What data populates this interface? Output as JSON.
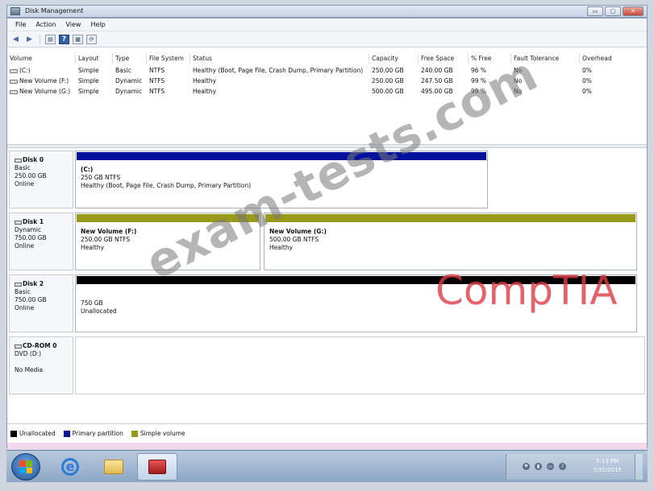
{
  "window": {
    "title": "Disk Management",
    "buttons": [
      "▭",
      "▢",
      "✕"
    ]
  },
  "menu": [
    "File",
    "Action",
    "View",
    "Help"
  ],
  "toolbar_icons": [
    "back-arrow-icon",
    "forward-arrow-icon",
    "console-icon",
    "help-icon",
    "properties-icon",
    "refresh-icon"
  ],
  "volume_list": {
    "columns": [
      "Volume",
      "Layout",
      "Type",
      "File System",
      "Status",
      "Capacity",
      "Free Space",
      "% Free",
      "Fault Tolerance",
      "Overhead"
    ],
    "rows": [
      [
        "(C:)",
        "Simple",
        "Basic",
        "NTFS",
        "Healthy (Boot, Page File, Crash Dump, Primary Partition)",
        "250.00 GB",
        "240.00 GB",
        "96 %",
        "No",
        "0%"
      ],
      [
        "New Volume (F:)",
        "Simple",
        "Dynamic",
        "NTFS",
        "Healthy",
        "250.00 GB",
        "247.50 GB",
        "99 %",
        "No",
        "0%"
      ],
      [
        "New Volume (G:)",
        "Simple",
        "Dynamic",
        "NTFS",
        "Healthy",
        "500.00 GB",
        "495.00 GB",
        "99 %",
        "No",
        "0%"
      ]
    ]
  },
  "disks": [
    {
      "name": "Disk 0",
      "type": "Basic",
      "size": "250.00 GB",
      "status": "Online",
      "partitions": [
        {
          "title": "(C:)",
          "detail": "250 GB NTFS",
          "status": "Healthy (Boot, Page File, Crash Dump, Primary Partition)",
          "color": "#00139a"
        }
      ]
    },
    {
      "name": "Disk 1",
      "type": "Dynamic",
      "size": "750.00 GB",
      "status": "Online",
      "partitions": [
        {
          "title": "New Volume (F:)",
          "detail": "250.00 GB NTFS",
          "status": "Healthy",
          "color": "#9a9a1a"
        },
        {
          "title": "New Volume (G:)",
          "detail": "500.00 GB NTFS",
          "status": "Healthy",
          "color": "#9a9a1a"
        }
      ]
    },
    {
      "name": "Disk 2",
      "type": "Basic",
      "size": "750.00 GB",
      "status": "Online",
      "partitions": [
        {
          "title": "",
          "detail": "750 GB",
          "status": "Unallocated",
          "color": "#000000"
        }
      ]
    },
    {
      "name": "CD-ROM 0",
      "type": "DVD (D:)",
      "size": "",
      "status": "No Media",
      "partitions": []
    }
  ],
  "legend": [
    {
      "label": "Unallocated",
      "color": "#000000"
    },
    {
      "label": "Primary partition",
      "color": "#00139a"
    },
    {
      "label": "Simple volume",
      "color": "#9a9a1a"
    }
  ],
  "watermark": {
    "text": "exam-tests.com",
    "logo": "CompTIA"
  },
  "taskbar": {
    "time": "5:13 PM",
    "date": "7/31/2015"
  }
}
